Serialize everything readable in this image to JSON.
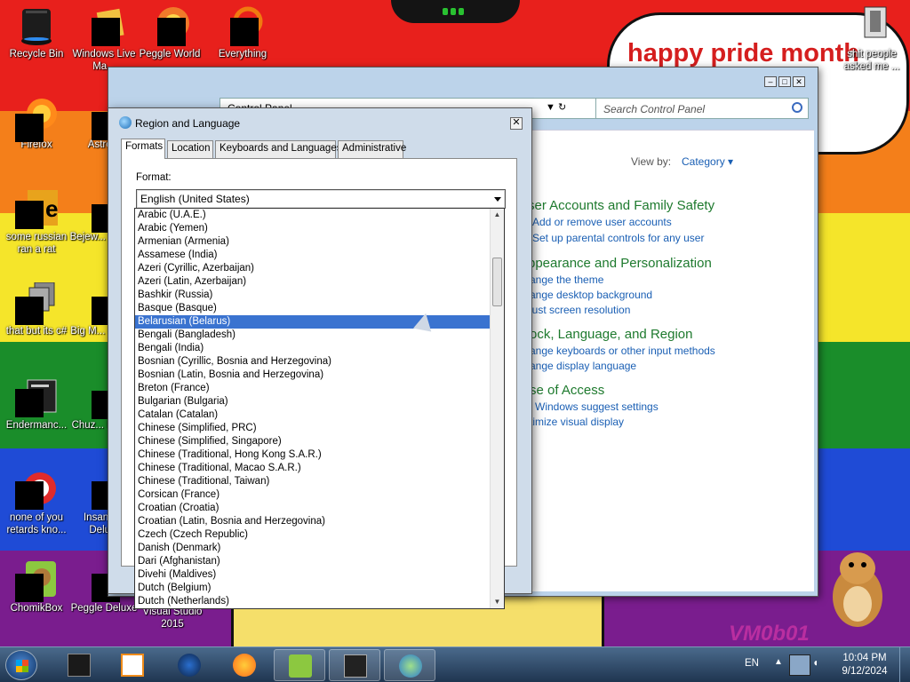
{
  "desktop": {
    "speech_text": "happy pride month",
    "vm_text": "VM0b01",
    "icons": [
      {
        "label": "Recycle Bin",
        "icon": "recycle-bin-icon"
      },
      {
        "label": "Windows Live Ma...",
        "icon": "windows-live-icon"
      },
      {
        "label": "Peggle World",
        "icon": "peggle-world-icon"
      },
      {
        "label": "Everything",
        "icon": "everything-icon"
      },
      {
        "label": "Firefox",
        "icon": "firefox-icon"
      },
      {
        "label": "Astro...",
        "icon": "app-icon"
      },
      {
        "label": "some russian ran a rat",
        "icon": "java-icon"
      },
      {
        "label": "Bejew... Delu...",
        "icon": "app-icon"
      },
      {
        "label": "that but its c#",
        "icon": "stacked-windows-icon"
      },
      {
        "label": "Big M... Delu...",
        "icon": "app-icon"
      },
      {
        "label": "Endermanc...",
        "icon": "console-icon"
      },
      {
        "label": "Chuz... Delu...",
        "icon": "app-icon"
      },
      {
        "label": "none of you retards kno...",
        "icon": "red-circle-icon"
      },
      {
        "label": "Insanic... Delu...",
        "icon": "app-icon"
      },
      {
        "label": "ChomikBox",
        "icon": "chomikbox-icon"
      },
      {
        "label": "Peggle Deluxe",
        "icon": "peggle-icon"
      },
      {
        "label": "Visual Studio 2015",
        "icon": "visual-studio-icon"
      },
      {
        "label": "shit people asked me ...",
        "icon": "file-icon"
      }
    ]
  },
  "control_panel": {
    "address": "Control Panel",
    "search_placeholder": "Search Control Panel",
    "view_by_label": "View by:",
    "view_by_value": "Category",
    "categories": [
      {
        "title": "ser Accounts and Family Safety",
        "links": [
          "Add or remove user accounts",
          "Set up parental controls for any user"
        ]
      },
      {
        "title": "ppearance and Personalization",
        "links": [
          "ange the theme",
          "ange desktop background",
          "just screen resolution"
        ]
      },
      {
        "title": "ock, Language, and Region",
        "links": [
          "ange keyboards or other input methods",
          "ange display language"
        ]
      },
      {
        "title": "se of Access",
        "links": [
          "Windows suggest settings",
          "timize visual display"
        ]
      }
    ]
  },
  "dialog": {
    "title": "Region and Language",
    "tabs": [
      "Formats",
      "Location",
      "Keyboards and Languages",
      "Administrative"
    ],
    "active_tab": "Formats",
    "format_label": "Format:",
    "format_value": "English (United States)",
    "options": [
      "Arabic (U.A.E.)",
      "Arabic (Yemen)",
      "Armenian (Armenia)",
      "Assamese (India)",
      "Azeri (Cyrillic, Azerbaijan)",
      "Azeri (Latin, Azerbaijan)",
      "Bashkir (Russia)",
      "Basque (Basque)",
      "Belarusian (Belarus)",
      "Bengali (Bangladesh)",
      "Bengali (India)",
      "Bosnian (Cyrillic, Bosnia and Herzegovina)",
      "Bosnian (Latin, Bosnia and Herzegovina)",
      "Breton (France)",
      "Bulgarian (Bulgaria)",
      "Catalan (Catalan)",
      "Chinese (Simplified, PRC)",
      "Chinese (Simplified, Singapore)",
      "Chinese (Traditional, Hong Kong S.A.R.)",
      "Chinese (Traditional, Macao S.A.R.)",
      "Chinese (Traditional, Taiwan)",
      "Corsican (France)",
      "Croatian (Croatia)",
      "Croatian (Latin, Bosnia and Herzegovina)",
      "Czech (Czech Republic)",
      "Danish (Denmark)",
      "Dari (Afghanistan)",
      "Divehi (Maldives)",
      "Dutch (Belgium)",
      "Dutch (Netherlands)"
    ],
    "highlighted_option": "Belarusian (Belarus)"
  },
  "taskbar": {
    "language": "EN",
    "time": "10:04 PM",
    "date": "9/12/2024",
    "apps": [
      "cmd-icon",
      "media-player-icon",
      "globe-icon",
      "firefox-icon",
      "chomikbox-icon",
      "screen-icon",
      "control-panel-icon"
    ]
  },
  "colors": {
    "selection": "#3a73d0",
    "cp_link": "#1a5fb4",
    "cp_category": "#1e7a2e",
    "speech_text": "#d51e1e"
  }
}
